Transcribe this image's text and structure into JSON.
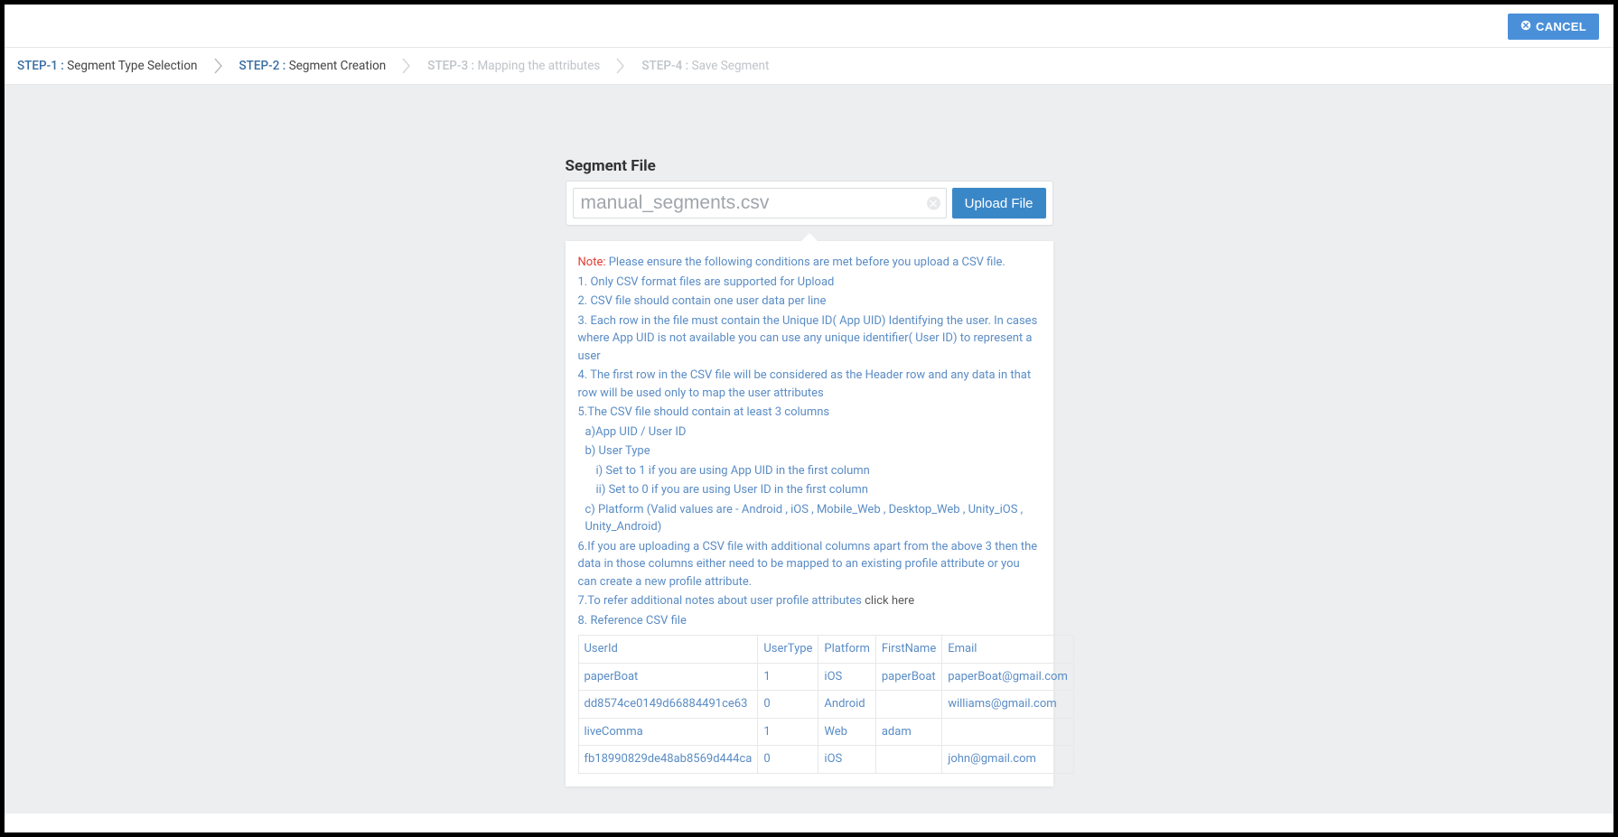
{
  "header": {
    "cancel_label": "CANCEL"
  },
  "steps": [
    {
      "prefix": "STEP-1 :",
      "title": "Segment Type Selection",
      "state": "active"
    },
    {
      "prefix": "STEP-2 :",
      "title": "Segment Creation",
      "state": "active"
    },
    {
      "prefix": "STEP-3 :",
      "title": "Mapping the attributes",
      "state": "inactive"
    },
    {
      "prefix": "STEP-4 :",
      "title": "Save Segment",
      "state": "inactive"
    }
  ],
  "segment_file": {
    "section_title": "Segment File",
    "placeholder": "manual_segments.csv",
    "value": "",
    "upload_label": "Upload File"
  },
  "notes": {
    "note_prefix": "Note:",
    "note_intro": " Please ensure the following conditions are met before you upload a CSV file.",
    "line1": "1. Only CSV format files are supported for Upload",
    "line2": "2. CSV file should contain one user data per line",
    "line3": "3. Each row in the file must contain the Unique ID( App UID) Identifying the user. In cases where App UID is not available you can use any unique identifier( User ID) to represent a user",
    "line4": "4. The first row in the CSV file will be considered as the Header row and any data in that row will be used only to map the user attributes",
    "line5": "5.The CSV file should contain at least 3 columns",
    "line5a": "a)App UID / User ID",
    "line5b": "b) User Type",
    "line5bi": "i) Set to 1 if you are using App UID in the first column",
    "line5bii": "ii) Set to 0 if you are using User ID in the first column",
    "line5c": "c) Platform (Valid values are - Android , iOS , Mobile_Web , Desktop_Web , Unity_iOS , Unity_Android)",
    "line6": "6.If you are uploading a CSV file with additional columns apart from the above 3 then the data in those columns either need to be mapped to an existing profile attribute or you can create a new profile attribute.",
    "line7_pre": "7.To refer additional notes about user profile attributes ",
    "line7_link": "click here",
    "line8": "8. Reference CSV file"
  },
  "ref_table": {
    "headers": [
      "UserId",
      "UserType",
      "Platform",
      "FirstName",
      "Email"
    ],
    "rows": [
      [
        "paperBoat",
        "1",
        "iOS",
        "paperBoat",
        "paperBoat@gmail.com"
      ],
      [
        "dd8574ce0149d66884491ce63",
        "0",
        "Android",
        "",
        "williams@gmail.com"
      ],
      [
        "liveComma",
        "1",
        "Web",
        "adam",
        ""
      ],
      [
        "fb18990829de48ab8569d444ca",
        "0",
        "iOS",
        "",
        "john@gmail.com"
      ]
    ]
  }
}
